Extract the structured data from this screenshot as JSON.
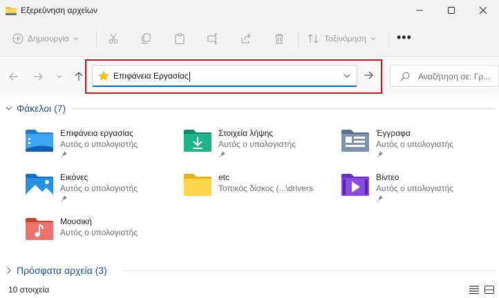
{
  "window": {
    "title": "Εξερεύνηση αρχείων"
  },
  "toolbar": {
    "new_label": "Δημιουργία",
    "sort_label": "Ταξινόμηση",
    "more_label": "•••"
  },
  "address": {
    "value": "Επιφάνεια Εργασίας",
    "search_placeholder": "Αναζήτηση σε: Γρ..."
  },
  "sections": {
    "folders_title": "Φάκελοι (7)",
    "recent_title": "Πρόσφατα αρχεία (3)"
  },
  "folders": [
    {
      "name": "Επιφάνεια εργασίας",
      "location": "Αυτός ο υπολογιστής",
      "pinned": true,
      "icon": "desktop-folder-icon"
    },
    {
      "name": "Στοιχεία λήψης",
      "location": "Αυτός ο υπολογιστής",
      "pinned": true,
      "icon": "downloads-folder-icon"
    },
    {
      "name": "Έγγραφα",
      "location": "Αυτός ο υπολογιστής",
      "pinned": true,
      "icon": "documents-folder-icon"
    },
    {
      "name": "Εικόνες",
      "location": "Αυτός ο υπολογιστής",
      "pinned": true,
      "icon": "pictures-folder-icon"
    },
    {
      "name": "etc",
      "location": "Τοπικός δίσκος (...\\drivers",
      "pinned": false,
      "icon": "folder-icon"
    },
    {
      "name": "Βίντεο",
      "location": "Αυτός ο υπολογιστής",
      "pinned": true,
      "icon": "videos-folder-icon"
    },
    {
      "name": "Μουσική",
      "location": "Αυτός ο υπολογιστής",
      "pinned": false,
      "icon": "music-folder-icon"
    }
  ],
  "status": {
    "item_count": "10 στοιχεία"
  },
  "colors": {
    "accent": "#0067c0",
    "highlight_border": "#d4101e",
    "section_text": "#1f4e8c"
  }
}
